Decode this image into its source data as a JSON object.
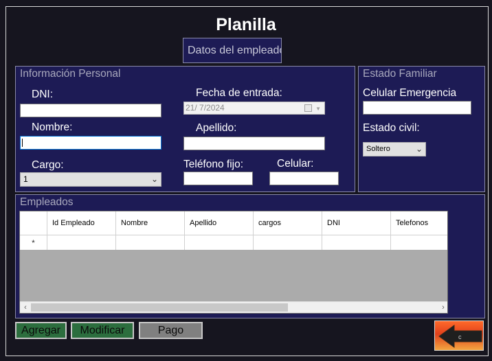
{
  "header": {
    "title": "Planilla",
    "section_button": "Datos del empleado"
  },
  "personal": {
    "group_title": "Información Personal",
    "dni_label": "DNI:",
    "dni_value": "",
    "fecha_label": "Fecha de entrada:",
    "fecha_value": "21/  7/2024",
    "nombre_label": "Nombre:",
    "nombre_value": "",
    "apellido_label": "Apellido:",
    "apellido_value": "",
    "cargo_label": "Cargo:",
    "cargo_value": "1",
    "telefono_label": "Teléfono fijo:",
    "telefono_value": "",
    "celular_label": "Celular:",
    "celular_value": ""
  },
  "familiar": {
    "group_title": "Estado Familiar",
    "celular_emergencia_label": "Celular Emergencia",
    "celular_emergencia_value": "",
    "estado_civil_label": "Estado civil:",
    "estado_civil_value": "Soltero"
  },
  "empleados": {
    "group_title": "Empleados",
    "columns": [
      "Id Empleado",
      "Nombre",
      "Apellido",
      "cargos",
      "DNI",
      "Telefonos"
    ],
    "new_row_marker": "*"
  },
  "actions": {
    "agregar": "Agregar",
    "modificar": "Modificar",
    "pago": "Pago",
    "back_icon_letter": "c"
  },
  "colors": {
    "window_bg": "#16151f",
    "group_bg": "#1d1b55",
    "button_green": "#2c6e3e",
    "button_gray": "#808080"
  }
}
